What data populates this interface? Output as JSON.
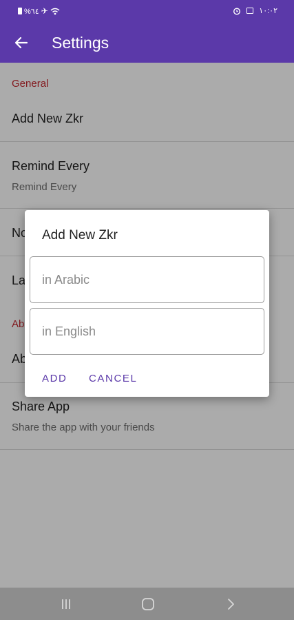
{
  "status_bar": {
    "left_text": "%٦٤",
    "right_text": "١٠:٠٢"
  },
  "app_bar": {
    "title": "Settings"
  },
  "settings": {
    "general_header": "General",
    "add_new_zkr": "Add New Zkr",
    "remind_every_title": "Remind Every",
    "remind_every_summary": "Remind Every",
    "notification_partial": "No",
    "language_partial": "La",
    "about_header_partial": "Ab",
    "about_partial": "Ab",
    "share_title": "Share App",
    "share_summary": "Share the app with your friends"
  },
  "dialog": {
    "title": "Add New Zkr",
    "arabic_placeholder": "in Arabic",
    "english_placeholder": "in English",
    "arabic_value": "",
    "english_value": "",
    "add_label": "ADD",
    "cancel_label": "CANCEL"
  },
  "colors": {
    "primary": "#5b39a9",
    "accent_header": "#c4262d"
  },
  "icons": [
    "battery-icon",
    "airplane-icon",
    "wifi-icon",
    "alarm-icon",
    "image-icon",
    "back-arrow-icon",
    "recents-icon",
    "home-icon",
    "back-nav-icon"
  ]
}
